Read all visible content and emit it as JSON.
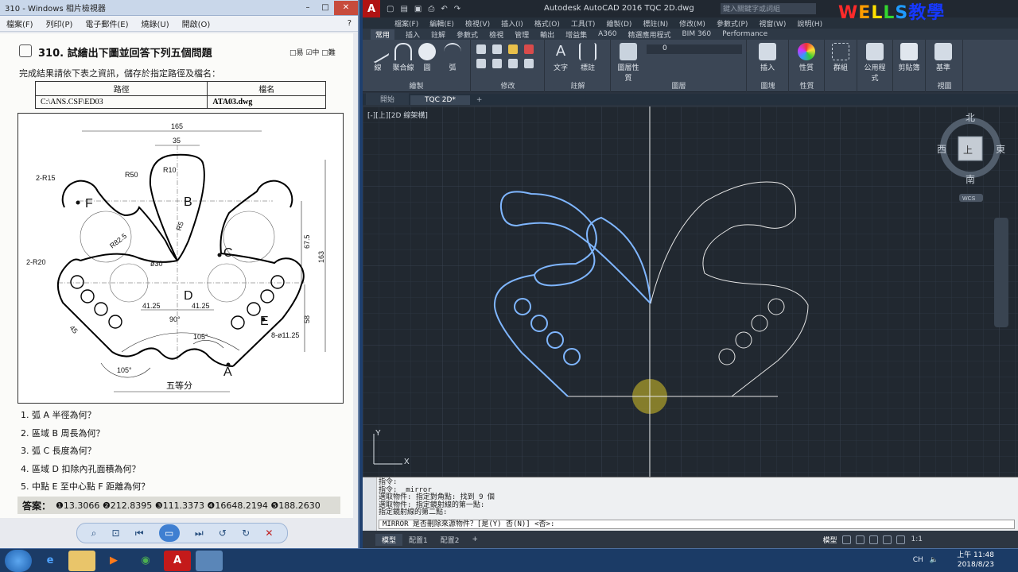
{
  "viewer": {
    "title": "310 - Windows 相片檢視器",
    "menu": [
      "檔案(F)",
      "列印(P)",
      "電子郵件(E)",
      "燒錄(U)",
      "開啟(O)"
    ],
    "help": "?",
    "paper": {
      "question_title": "310.  試繪出下圖並回答下列五個問題",
      "difficulty": "□易 ☑中 □難",
      "instruction": "完成結果請依下表之資訊，儲存於指定路徑及檔名：",
      "table": {
        "headers": [
          "路徑",
          "檔名"
        ],
        "row": [
          "C:\\ANS.CSF\\ED03",
          "ATA03.dwg"
        ]
      },
      "drawing_labels": {
        "d165": "165",
        "d35": "35",
        "r15": "2-R15",
        "r50": "R50",
        "r10": "R10",
        "r825": "R82.5",
        "r5": "R5",
        "r20": "2-R20",
        "dia30": "ø30",
        "d675": "67.5",
        "d163": "163",
        "d58": "58",
        "d4125a": "41.25",
        "d4125b": "41.25",
        "ang90": "90°",
        "d45": "45",
        "ang105a": "105°",
        "ang105b": "105°",
        "holes": "8-ø11.25",
        "equal": "五等分",
        "lblF": "F",
        "lblB": "B",
        "lblC": "C",
        "lblD": "D",
        "lblE": "E",
        "lblA": "A"
      },
      "questions": [
        "1. 弧 A 半徑為何？",
        "2. 區域 B 周長為何？",
        "3. 弧 C 長度為何？",
        "4. 區域 D 扣除內孔面積為何？",
        "5. 中點 E 至中心點 F 距離為何？"
      ],
      "answers_label": "答案：",
      "answers": "❶13.3066 ❷212.8395 ❸111.3373 ❹16648.2194 ❺188.2630"
    }
  },
  "acad": {
    "app_title": "Autodesk AutoCAD 2016    TQC 2D.dwg",
    "search_placeholder": "鍵入關鍵字或詞組",
    "brand": {
      "w": "W",
      "e": "E",
      "l1": "L",
      "l2": "L",
      "s": "S",
      "cn": "教學"
    },
    "menu": [
      "檔案(F)",
      "編輯(E)",
      "檢視(V)",
      "插入(I)",
      "格式(O)",
      "工具(T)",
      "繪製(D)",
      "標註(N)",
      "修改(M)",
      "參數式(P)",
      "視窗(W)",
      "說明(H)"
    ],
    "ribbon_tabs": [
      "常用",
      "插入",
      "註解",
      "參數式",
      "檢視",
      "管理",
      "輸出",
      "增益集",
      "A360",
      "精選應用程式",
      "BIM 360",
      "Performance"
    ],
    "ribbon_groups": {
      "draw": "繪製",
      "modify": "修改",
      "annotation": "註解",
      "layers": "圖層",
      "block": "圖塊",
      "properties": "性質",
      "groups": "群組",
      "utilities": "公用程式",
      "clipboard": "剪貼簿",
      "view": "視圖",
      "line": "線",
      "polyline": "聚合線",
      "circle": "圓",
      "arc": "弧",
      "text": "文字",
      "dim": "標註",
      "layer_props": "圖層性質",
      "insert": "插入",
      "prop_btn": "性質",
      "group_btn": "群組",
      "util_btn": "公用程式",
      "clip_btn": "剪貼簿",
      "base_btn": "基準",
      "layer_value": "0"
    },
    "doc_tabs": [
      "開始",
      "TQC 2D*"
    ],
    "viewport_label": "[-][上][2D 線架構]",
    "viewcube": {
      "north": "北",
      "south": "南",
      "east": "東",
      "west": "西",
      "top": "上",
      "wcs": "WCS"
    },
    "ucs": {
      "x": "X",
      "y": "Y"
    },
    "command_history": [
      "指令:",
      "指令:  _mirror",
      "選取物件:  指定對角點: 找到 9 個",
      "選取物件:  指定鏡射線的第一點:",
      "指定鏡射線的第二點:"
    ],
    "command_prompt": "MIRROR 是否刪除來源物件？[是(Y) 否(N)] <否>:",
    "layout_tabs": [
      "模型",
      "配置1",
      "配置2"
    ],
    "status": {
      "model": "模型",
      "scale": "1:1"
    }
  },
  "taskbar": {
    "time": "上午 11:48",
    "date": "2018/8/23",
    "lang": "CH"
  }
}
